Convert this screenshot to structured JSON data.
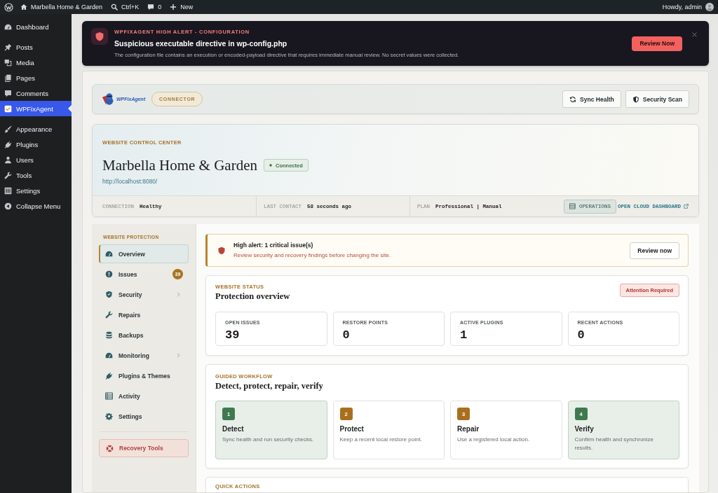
{
  "admin_bar": {
    "site_name": "Marbella Home & Garden",
    "search_shortcut": "Ctrl+K",
    "comment_count": "0",
    "new_label": "New",
    "greeting": "Howdy, admin"
  },
  "admin_menu": {
    "groups": [
      {
        "items": [
          {
            "label": "Dashboard",
            "selected": false
          }
        ]
      },
      {
        "items": [
          {
            "label": "Posts",
            "selected": false
          },
          {
            "label": "Media",
            "selected": false
          },
          {
            "label": "Pages",
            "selected": false
          },
          {
            "label": "Comments",
            "selected": false
          },
          {
            "label": "WPFixAgent",
            "selected": true
          }
        ]
      },
      {
        "items": [
          {
            "label": "Appearance",
            "selected": false
          },
          {
            "label": "Plugins",
            "selected": false
          },
          {
            "label": "Users",
            "selected": false
          },
          {
            "label": "Tools",
            "selected": false
          },
          {
            "label": "Settings",
            "selected": false
          }
        ]
      }
    ],
    "collapse_label": "Collapse Menu"
  },
  "alert_banner": {
    "eyebrow": "WPFIXAGENT HIGH ALERT - CONFIGURATION",
    "title": "Suspicious executable directive in wp-config.php",
    "description": "The configuration file contains an execution or encoded-payload directive that requires immediate manual review. No secret values were collected.",
    "button": "Review Now"
  },
  "connector_bar": {
    "logo_text": "WPFixAgent",
    "badge": "CONNECTOR",
    "buttons": [
      {
        "label": "Sync Health"
      },
      {
        "label": "Security Scan"
      }
    ]
  },
  "hero": {
    "eyebrow": "WEBSITE CONTROL CENTER",
    "site_name": "Marbella Home & Garden",
    "status": "Connected",
    "connected": true,
    "url": "http://localhost:8080/",
    "meta": [
      {
        "label": "CONNECTION",
        "value": "Healthy"
      },
      {
        "label": "LAST CONTACT",
        "value": "58 seconds ago"
      },
      {
        "label": "PLAN",
        "value": "Professional | Manual"
      }
    ],
    "operations_button": "OPERATIONS",
    "cloud_link": "OPEN CLOUD DASHBOARD"
  },
  "plugin_nav": {
    "heading": "WEBSITE PROTECTION",
    "items": [
      {
        "label": "Overview",
        "selected": true,
        "has_submenu": false
      },
      {
        "label": "Issues",
        "selected": false,
        "has_submenu": false,
        "count": "39"
      },
      {
        "label": "Security",
        "selected": false,
        "has_submenu": true
      },
      {
        "label": "Repairs",
        "selected": false,
        "has_submenu": false
      },
      {
        "label": "Backups",
        "selected": false,
        "has_submenu": false
      },
      {
        "label": "Monitoring",
        "selected": false,
        "has_submenu": true
      },
      {
        "label": "Plugins & Themes",
        "selected": false,
        "has_submenu": false
      },
      {
        "label": "Activity",
        "selected": false,
        "has_submenu": false
      },
      {
        "label": "Settings",
        "selected": false,
        "has_submenu": false
      }
    ],
    "recovery_button": "Recovery Tools"
  },
  "critical_alert": {
    "title": "High alert: 1 critical issue(s)",
    "message": "Review security and recovery findings before changing the site.",
    "button": "Review now"
  },
  "website_status": {
    "eyebrow": "WEBSITE STATUS",
    "title": "Protection overview",
    "badge": "Attention Required",
    "stats": [
      {
        "label": "OPEN ISSUES",
        "value": "39"
      },
      {
        "label": "RESTORE POINTS",
        "value": "0"
      },
      {
        "label": "ACTIVE PLUGINS",
        "value": "1"
      },
      {
        "label": "RECENT ACTIONS",
        "value": "0"
      }
    ]
  },
  "workflow": {
    "eyebrow": "GUIDED WORKFLOW",
    "title": "Detect, protect, repair, verify",
    "steps": [
      {
        "number": "1",
        "title": "Detect",
        "description": "Sync health and run security checks.",
        "done": true
      },
      {
        "number": "2",
        "title": "Protect",
        "description": "Keep a recent local restore point.",
        "done": false
      },
      {
        "number": "3",
        "title": "Repair",
        "description": "Use a registered local action.",
        "done": false
      },
      {
        "number": "4",
        "title": "Verify",
        "description": "Confirm health and synchronize results.",
        "done": true
      }
    ]
  },
  "quick_actions": {
    "eyebrow": "QUICK ACTIONS"
  }
}
